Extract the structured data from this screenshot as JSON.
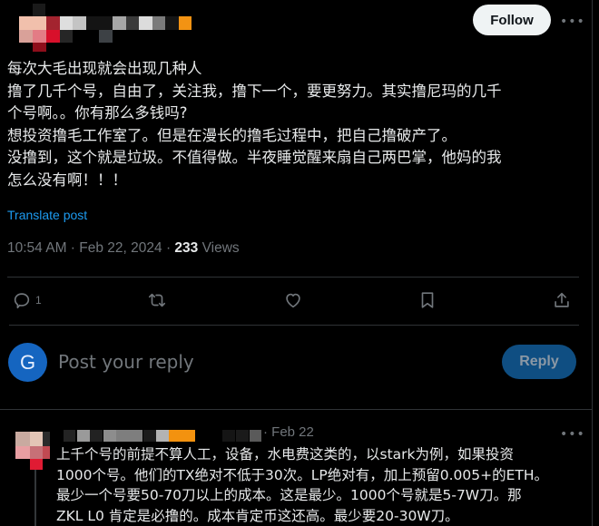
{
  "header": {
    "author_redacted": true,
    "follow_label": "Follow",
    "more_label": "•••"
  },
  "post": {
    "lines": [
      "每次大毛出现就会出现几种人",
      "撸了几千个号，自由了，关注我，撸下一个，要更努力。其实撸尼玛的几千",
      "个号啊。。你有那么多钱吗?",
      "想投资撸毛工作室了。但是在漫长的撸毛过程中，把自己撸破产了。",
      "没撸到，这个就是垃圾。不值得做。半夜睡觉醒来扇自己两巴掌，他妈的我",
      "怎么没有啊！！！"
    ],
    "translate_label": "Translate post",
    "time": "10:54 AM",
    "date": "Feb 22, 2024",
    "separator": " · ",
    "views_count": "233",
    "views_label": " Views"
  },
  "actions": {
    "reply_count": "1",
    "items": [
      {
        "name": "reply",
        "icon": "reply-icon"
      },
      {
        "name": "repost",
        "icon": "repost-icon"
      },
      {
        "name": "like",
        "icon": "like-icon"
      },
      {
        "name": "bookmark",
        "icon": "bookmark-icon"
      },
      {
        "name": "share",
        "icon": "share-icon"
      }
    ]
  },
  "composer": {
    "avatar_letter": "G",
    "placeholder": "Post your reply",
    "reply_label": "Reply"
  },
  "comment": {
    "author_redacted": true,
    "date": "· Feb 22",
    "more_label": "•••",
    "lines": [
      "上千个号的前提不算人工，设备，水电费这类的，以stark为例，如果投资",
      "1000个号。他们的TX绝对不低于30次。LP绝对有，加上预留0.005+的ETH。",
      "最少一个号要50-70刀以上的成本。这是最少。1000个号就是5-7W刀。那",
      "ZKL L0 肯定是必撸的。成本肯定币这还高。最少要20-30W刀。"
    ]
  },
  "colors": {
    "background": "#000000",
    "text": "#e7e9ea",
    "muted": "#71767b",
    "link": "#1d9bf0",
    "divider": "#2f3336",
    "avatar_blue": "#1565c0",
    "reply_button": "#0f4e82",
    "follow_button": "#eff3f4"
  }
}
